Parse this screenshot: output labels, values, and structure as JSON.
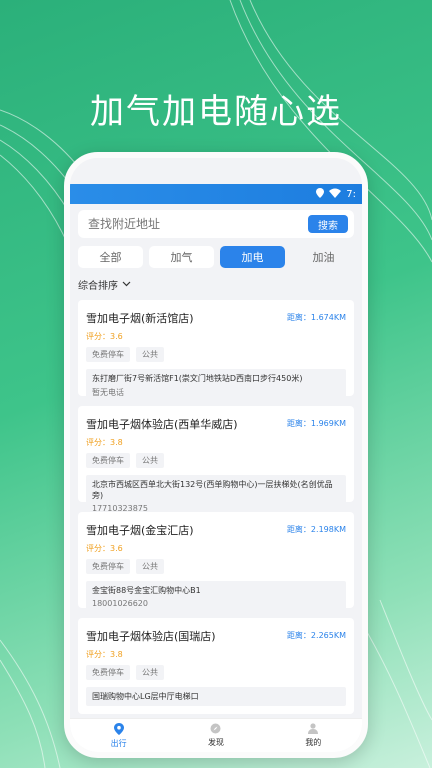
{
  "headline": "加气加电随心选",
  "status": {
    "time": "7:"
  },
  "search": {
    "placeholder": "查找附近地址",
    "button": "搜索"
  },
  "tabs": [
    {
      "label": "全部"
    },
    {
      "label": "加气"
    },
    {
      "label": "加电"
    },
    {
      "label": "加油"
    }
  ],
  "sort": {
    "label": "综合排序"
  },
  "stations": [
    {
      "name": "雪加电子烟(新活馆店)",
      "distance": "距离：1.674KM",
      "rating": "评分：3.6",
      "tags": [
        "免费停车",
        "公共"
      ],
      "address": "东打磨厂街7号新活馆F1(崇文门地铁站D西南口步行450米)",
      "phone": "暂无电话"
    },
    {
      "name": "雪加电子烟体验店(西单华威店)",
      "distance": "距离：1.969KM",
      "rating": "评分：3.8",
      "tags": [
        "免费停车",
        "公共"
      ],
      "address": "北京市西城区西单北大街132号(西单购物中心)一层扶梯处(名创优品旁)",
      "phone": "17710323875"
    },
    {
      "name": "雪加电子烟(金宝汇店)",
      "distance": "距离：2.198KM",
      "rating": "评分：3.6",
      "tags": [
        "免费停车",
        "公共"
      ],
      "address": "金宝街88号金宝汇购物中心B1",
      "phone": "18001026620"
    },
    {
      "name": "雪加电子烟体验店(国瑞店)",
      "distance": "距离：2.265KM",
      "rating": "评分：3.8",
      "tags": [
        "免费停车",
        "公共"
      ],
      "address": "国瑞购物中心LG层中厅电梯口",
      "phone": ""
    }
  ],
  "bottom_nav": [
    {
      "label": "出行",
      "icon": "location-pin-icon"
    },
    {
      "label": "发现",
      "icon": "compass-icon"
    },
    {
      "label": "我的",
      "icon": "person-icon"
    }
  ],
  "colors": {
    "accent": "#2b83ea",
    "rating": "#f0a020",
    "background": "#3ec48a"
  }
}
